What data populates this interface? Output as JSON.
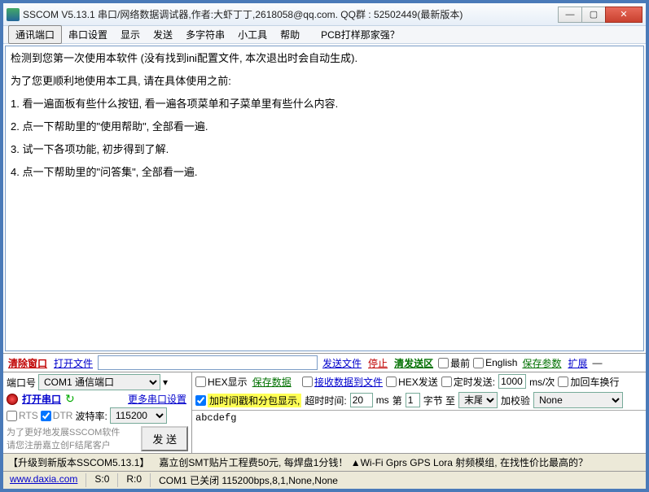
{
  "titlebar": {
    "text": "SSCOM V5.13.1 串口/网络数据调试器,作者:大虾丁丁,2618058@qq.com. QQ群 : 52502449(最新版本)"
  },
  "menu": {
    "items": [
      "通讯端口",
      "串口设置",
      "显示",
      "发送",
      "多字符串",
      "小工具",
      "帮助"
    ],
    "pcb": "PCB打样那家强？"
  },
  "content": {
    "lines": [
      "检测到您第一次使用本软件 (没有找到ini配置文件, 本次退出时会自动生成).",
      "为了您更顺利地使用本工具, 请在具体使用之前:",
      "1. 看一遍面板有些什么按钮, 看一遍各项菜单和子菜单里有些什么内容.",
      "2. 点一下帮助里的\"使用帮助\", 全部看一遍.",
      "3. 试一下各项功能, 初步得到了解.",
      "4. 点一下帮助里的\"问答集\", 全部看一遍."
    ]
  },
  "tb1": {
    "clear_window": "清除窗口",
    "open_file": "打开文件",
    "send_file": "发送文件",
    "stop": "停止",
    "clear_send": "清发送区",
    "front": "最前",
    "english": "English",
    "save_params": "保存参数",
    "extend": "扩展"
  },
  "row2": {
    "port_label": "端口号",
    "port_value": "COM1 通信端口",
    "hex_display": "HEX显示",
    "save_data": "保存数据",
    "recv_to_file": "接收数据到文件",
    "hex_send": "HEX发送",
    "timed_send": "定时发送:",
    "interval_value": "1000",
    "interval_unit": "ms/次",
    "add_crlf": "加回车换行"
  },
  "row3": {
    "open_port": "打开串口",
    "more_settings": "更多串口设置",
    "timestamp_pkg": "加时间戳和分包显示,",
    "timeout_label": "超时时间:",
    "timeout_value": "20",
    "timeout_unit": "ms",
    "page_label1": "第",
    "page_value": "1",
    "page_label2": "字节 至",
    "tail_value": "末尾",
    "add_check": "加校验",
    "check_value": "None"
  },
  "row4": {
    "rts": "RTS",
    "dtr": "DTR",
    "baud_label": "波特率:",
    "baud_value": "115200"
  },
  "sendbox": {
    "value": "abcdefg"
  },
  "promo": {
    "line1": "为了更好地发展SSCOM软件",
    "line2": "请您注册嘉立创F结尾客户",
    "send_btn": "发  送"
  },
  "status1": {
    "upgrade": "【升级到新版本SSCOM5.13.1】",
    "ad": "嘉立创SMT贴片工程费50元, 每焊盘1分钱！  ▲Wi-Fi Gprs GPS Lora 射频模组, 在找性价比最高的？"
  },
  "status2": {
    "url": "www.daxia.com",
    "s": "S:0",
    "r": "R:0",
    "com": "COM1 已关闭  115200bps,8,1,None,None"
  }
}
